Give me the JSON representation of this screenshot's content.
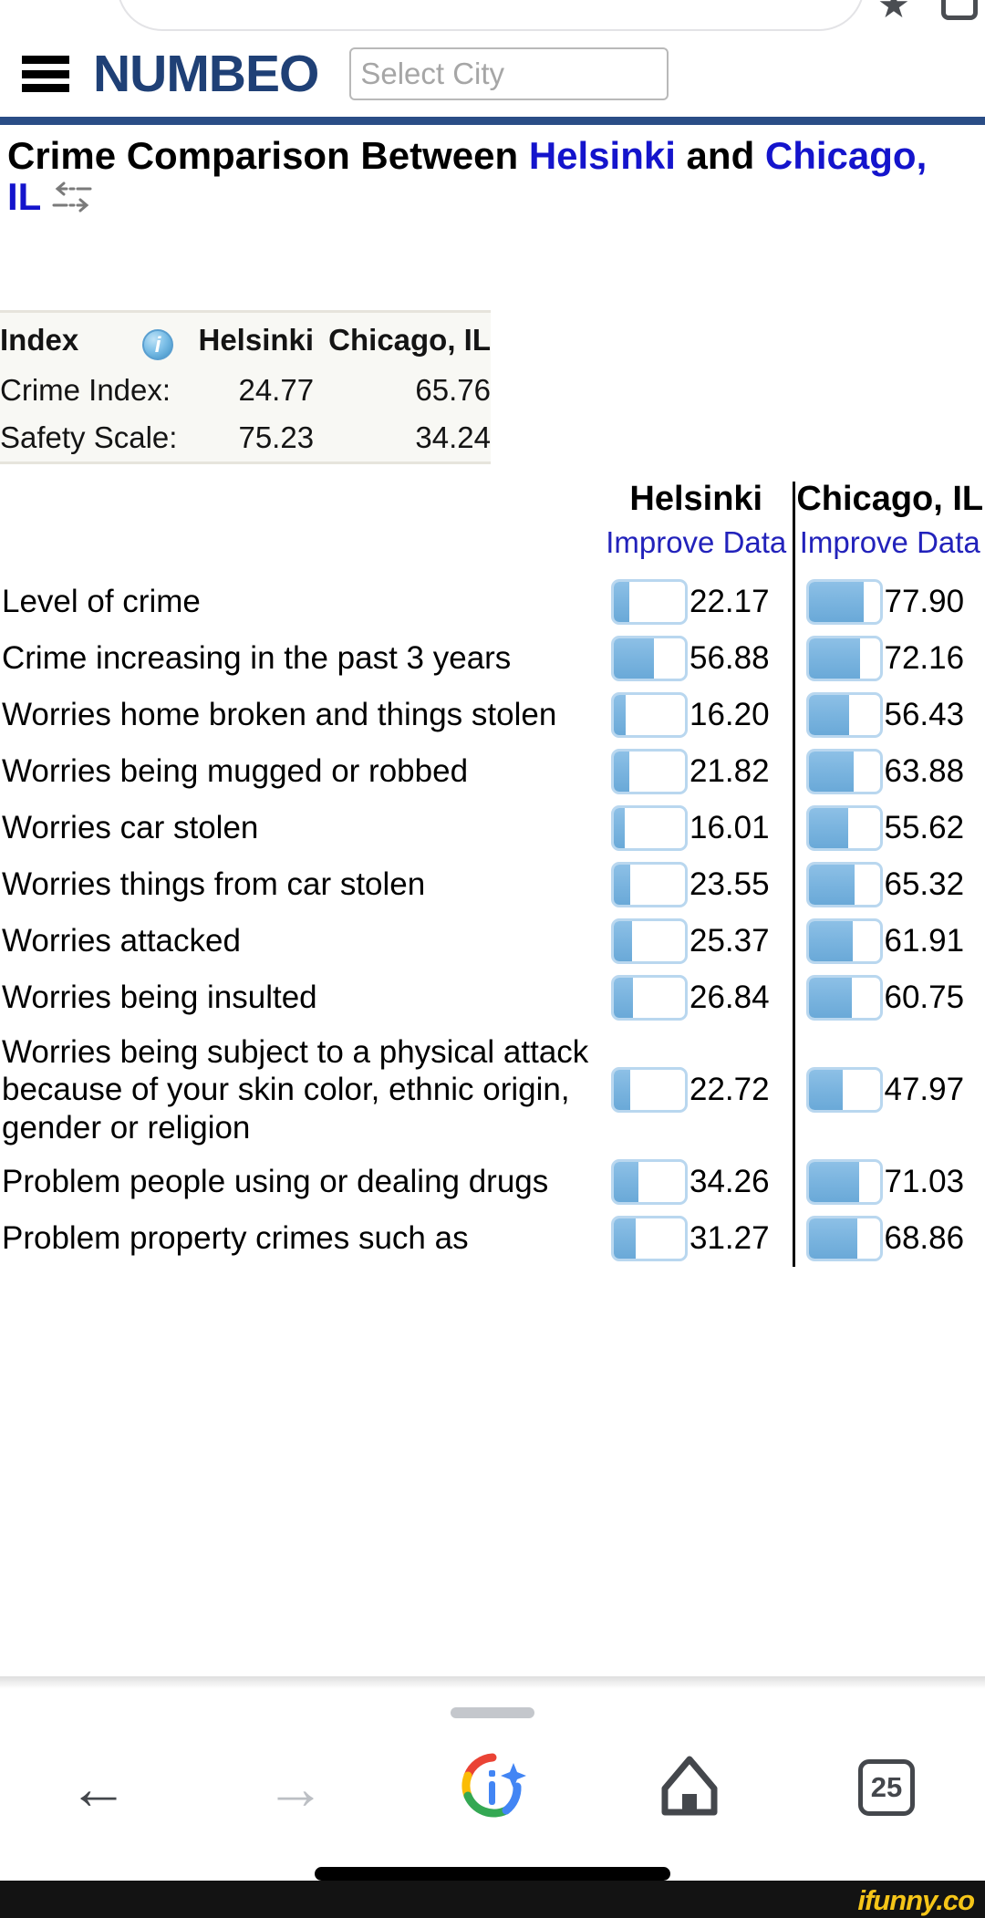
{
  "browser": {
    "top_icons": [
      "star-icon",
      "tabs-icon"
    ],
    "bottom_nav": {
      "back_label": "←",
      "forward_label": "→",
      "lens_label": "google-lens",
      "home_label": "home",
      "tab_count": "25"
    }
  },
  "site": {
    "brand": "NUMBEO",
    "menu_icon": "hamburger-icon",
    "city_select_placeholder": "Select City",
    "city_select_value": ""
  },
  "title": {
    "prefix": "Crime Comparison Between ",
    "city_a": "Helsinki",
    "middle": " and ",
    "city_b": "Chicago, IL",
    "swap_icon": "swap-arrows-icon"
  },
  "index_table": {
    "headers": {
      "index": "Index",
      "info_icon": "info-icon",
      "city_a": "Helsinki",
      "city_b": "Chicago, IL"
    },
    "rows": [
      {
        "label": "Crime Index:",
        "city_a": "24.77",
        "city_b": "65.76"
      },
      {
        "label": "Safety Scale:",
        "city_a": "75.23",
        "city_b": "34.24"
      }
    ]
  },
  "comparison": {
    "col_a_title": "Helsinki",
    "col_b_title": "Chicago, IL",
    "improve_a": "Improve Data",
    "improve_b": "Improve Data"
  },
  "chart_data": {
    "type": "bar",
    "title": "Crime Comparison Between Helsinki and Chicago, IL",
    "xlabel": "",
    "ylabel": "",
    "xlim": [
      0,
      100
    ],
    "grid": false,
    "legend_position": "top",
    "categories": [
      "Level of crime",
      "Crime increasing in the past 3 years",
      "Worries home broken and things stolen",
      "Worries being mugged or robbed",
      "Worries car stolen",
      "Worries things from car stolen",
      "Worries attacked",
      "Worries being insulted",
      "Worries being subject to a physical attack because of your skin color, ethnic origin, gender or religion",
      "Problem people using or dealing drugs",
      "Problem property crimes such as"
    ],
    "series": [
      {
        "name": "Helsinki",
        "values": [
          22.17,
          56.88,
          16.2,
          21.82,
          16.01,
          23.55,
          25.37,
          26.84,
          22.72,
          34.26,
          31.27
        ]
      },
      {
        "name": "Chicago, IL",
        "values": [
          77.9,
          72.16,
          56.43,
          63.88,
          55.62,
          65.32,
          61.91,
          60.75,
          47.97,
          71.03,
          68.86
        ]
      }
    ],
    "value_labels": {
      "Helsinki": [
        "22.17",
        "56.88",
        "16.20",
        "21.82",
        "16.01",
        "23.55",
        "25.37",
        "26.84",
        "22.72",
        "34.26",
        "31.27"
      ],
      "Chicago, IL": [
        "77.90",
        "72.16",
        "56.43",
        "63.88",
        "55.62",
        "65.32",
        "61.91",
        "60.75",
        "47.97",
        "71.03",
        "68.86"
      ]
    }
  },
  "watermark": "ifunny.co",
  "colors": {
    "brand_blue": "#1f4076",
    "rule_blue": "#2a4d86",
    "link_blue": "#1414cc",
    "bar_fill": "#7ab4df",
    "bar_border": "#b9d7ef",
    "watermark": "#f5c518"
  }
}
